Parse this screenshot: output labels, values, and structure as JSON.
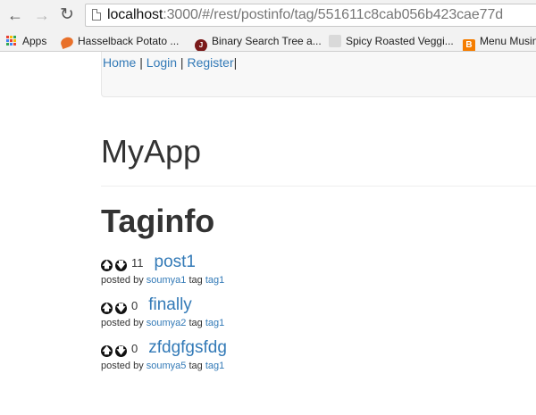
{
  "browser": {
    "url_host": "localhost",
    "url_rest": ":3000/#/rest/postinfo/tag/551611c8cab056b423cae77d",
    "bookmarks": [
      {
        "label": "Apps"
      },
      {
        "label": "Hasselback Potato ..."
      },
      {
        "label": "Binary Search Tree a..."
      },
      {
        "label": "Spicy Roasted Veggi..."
      },
      {
        "label": "Menu Musin"
      }
    ]
  },
  "navbar": {
    "home": "Home",
    "sep1": " | ",
    "login": "Login",
    "sep2": " | ",
    "register": "Register",
    "sep3": "|"
  },
  "app_title": "MyApp",
  "section_title": "Taginfo",
  "labels": {
    "posted_by": "posted by",
    "tag": "tag",
    "up_icon": "🡅",
    "down_icon": "🡇"
  },
  "posts": [
    {
      "votes": "11",
      "title": "post1",
      "author": "soumya1",
      "tag": "tag1"
    },
    {
      "votes": "0",
      "title": "finally",
      "author": "soumya2",
      "tag": "tag1"
    },
    {
      "votes": "0",
      "title": "zfdgfgsfdg",
      "author": "soumya5",
      "tag": "tag1"
    }
  ]
}
